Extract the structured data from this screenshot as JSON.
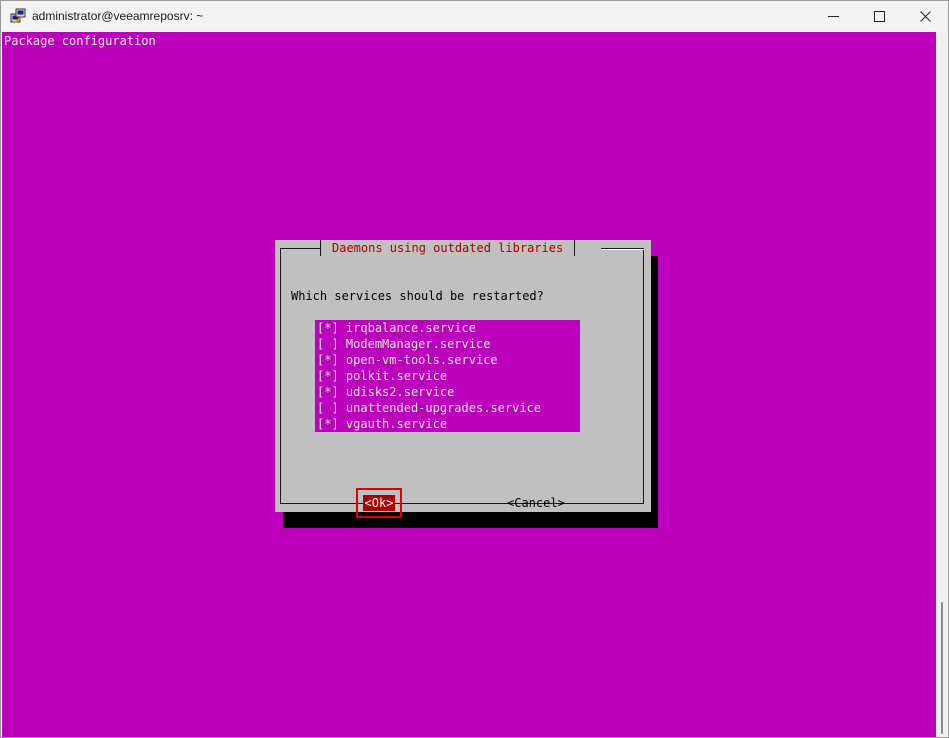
{
  "window": {
    "title": "administrator@veeamreposrv: ~"
  },
  "terminal": {
    "header": "Package configuration"
  },
  "dialog": {
    "title": "Daemons using outdated libraries",
    "question": "Which services should be restarted?",
    "services": [
      {
        "checkbox": "[*]",
        "name": "irqbalance.service",
        "checked": true
      },
      {
        "checkbox": "[ ]",
        "name": "ModemManager.service",
        "checked": false
      },
      {
        "checkbox": "[*]",
        "name": "open-vm-tools.service",
        "checked": true
      },
      {
        "checkbox": "[*]",
        "name": "polkit.service",
        "checked": true
      },
      {
        "checkbox": "[*]",
        "name": "udisks2.service",
        "checked": true
      },
      {
        "checkbox": "[ ]",
        "name": "unattended-upgrades.service",
        "checked": false
      },
      {
        "checkbox": "[*]",
        "name": "vgauth.service",
        "checked": true
      }
    ],
    "ok_label": "<Ok>",
    "cancel_label": "<Cancel>"
  },
  "colors": {
    "terminal_background": "#bb00bb",
    "dialog_background": "#c0c0c0",
    "title_text": "#aa0000",
    "ok_button_background": "#aa0000",
    "highlight_box": "#e00000"
  },
  "icons": {
    "app": "putty-icon",
    "minimize": "minimize-icon",
    "maximize": "maximize-icon",
    "close": "close-icon"
  }
}
